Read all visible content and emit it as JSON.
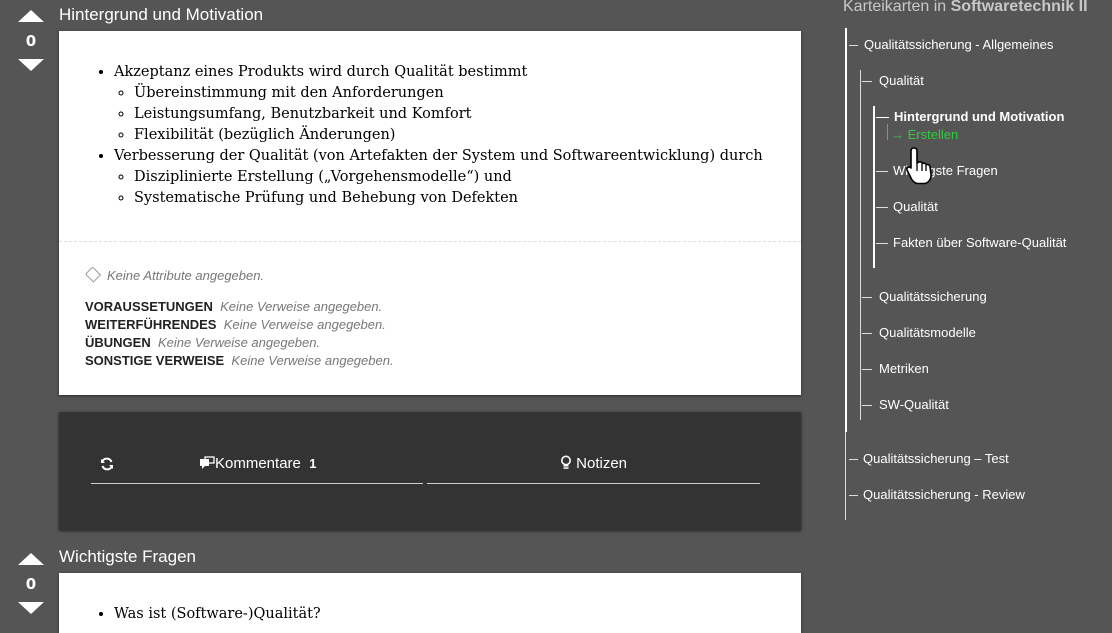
{
  "cards": [
    {
      "vote_count": "0",
      "title": "Hintergrund und Motivation",
      "bullets": [
        {
          "text": "Akzeptanz eines Produkts wird durch Qualität bestimmt",
          "sub": [
            "Übereinstimmung mit den Anforderungen",
            "Leistungsumfang, Benutzbarkeit und Komfort",
            "Flexibilität (bezüglich Änderungen)"
          ]
        },
        {
          "text": "Verbesserung der Qualität (von Artefakten der System und Softwareentwicklung) durch",
          "sub": [
            "Disziplinierte Erstellung („Vorgehensmodelle“) und",
            "Systematische Prüfung und Behebung von Defekten"
          ]
        }
      ],
      "attributes_text": "Keine Attribute angegeben.",
      "references": [
        {
          "label": "VORAUSSETUNGEN",
          "value": "Keine Verweise angegeben."
        },
        {
          "label": "WEITERFÜHRENDES",
          "value": "Keine Verweise angegeben."
        },
        {
          "label": "ÜBUNGEN",
          "value": "Keine Verweise angegeben."
        },
        {
          "label": "SONSTIGE VERWEISE",
          "value": "Keine Verweise angegeben."
        }
      ]
    },
    {
      "vote_count": "0",
      "title": "Wichtigste Fragen",
      "bullets": [
        {
          "text": "Was ist (Software-)Qualität?"
        }
      ]
    }
  ],
  "tabs": {
    "refresh_icon": "refresh-icon",
    "comments_icon": "comments-icon",
    "comments_label": "Kommentare",
    "comments_count": "1",
    "notes_icon": "lightbulb-icon",
    "notes_label": "Notizen"
  },
  "sidebar": {
    "header_prefix": "Karteikarten in",
    "header_course": "Softwaretechnik II",
    "items": [
      {
        "label": "Qualitätssicherung - Allgemeines"
      },
      {
        "label": "Qualität"
      },
      {
        "label": "Hintergrund und Motivation",
        "active": true
      },
      {
        "label": "→ Erstellen"
      },
      {
        "label": "Wichtigste Fragen"
      },
      {
        "label": "Qualität"
      },
      {
        "label": "Fakten über Software-Qualität"
      },
      {
        "label": "Qualitätssicherung"
      },
      {
        "label": "Qualitätsmodelle"
      },
      {
        "label": "Metriken"
      },
      {
        "label": "SW-Qualität"
      },
      {
        "label": "Qualitätssicherung – Test"
      },
      {
        "label": "Qualitätssicherung - Review"
      }
    ]
  },
  "colors": {
    "background": "#555555",
    "panel": "#333333",
    "accent_green": "#2ecc40"
  },
  "cursor_icon": "hand-pointer-icon"
}
